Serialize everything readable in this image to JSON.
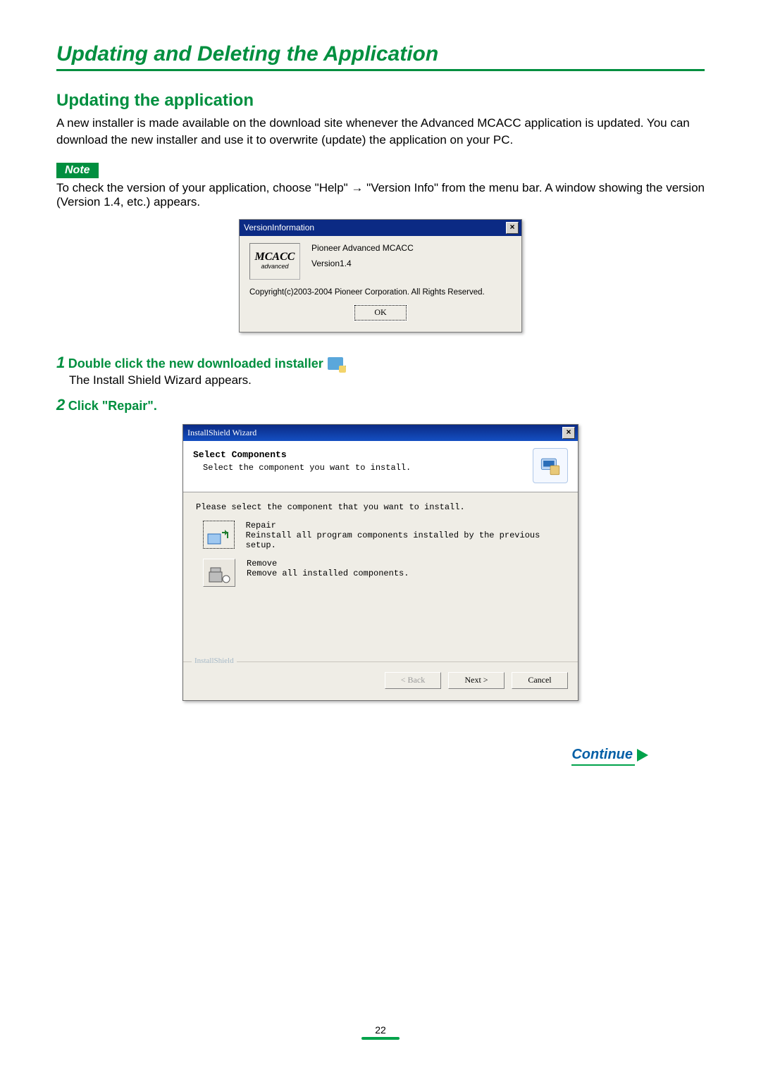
{
  "heading_main": "Updating and Deleting the Application",
  "heading_sub": "Updating the application",
  "intro": "A new installer is made available on the download site whenever the Advanced MCACC application is updated. You can download the new installer and use it to overwrite (update) the application on your PC.",
  "note_label": "Note",
  "note_text_a": "To check the version of your application, choose \"Help\"",
  "note_arrow": "→",
  "note_text_b": "\"Version Info\" from the menu bar. A window showing the version (Version 1.4, etc.) appears.",
  "version_dialog": {
    "title": "VersionInformation",
    "logo_main": "MCACC",
    "logo_sub": "advanced",
    "product": "Pioneer Advanced MCACC",
    "version": "Version1.4",
    "copyright": "Copyright(c)2003-2004 Pioneer Corporation. All Rights Reserved.",
    "ok": "OK"
  },
  "steps": {
    "s1_num": "1",
    "s1_label": "Double click the new downloaded installer",
    "s1_desc": "The Install Shield Wizard appears.",
    "s2_num": "2",
    "s2_label": "Click \"Repair\"."
  },
  "install_dialog": {
    "title": "InstallShield Wizard",
    "header_title": "Select Components",
    "header_desc": "Select the component you want to install.",
    "body_prompt": "Please select the component that you want to install.",
    "repair_title": "Repair",
    "repair_desc": "Reinstall all program components installed by the previous setup.",
    "remove_title": "Remove",
    "remove_desc": "Remove all installed components.",
    "brand": "InstallShield",
    "btn_back": "< Back",
    "btn_next": "Next >",
    "btn_cancel": "Cancel"
  },
  "continue": "Continue",
  "page_number": "22"
}
